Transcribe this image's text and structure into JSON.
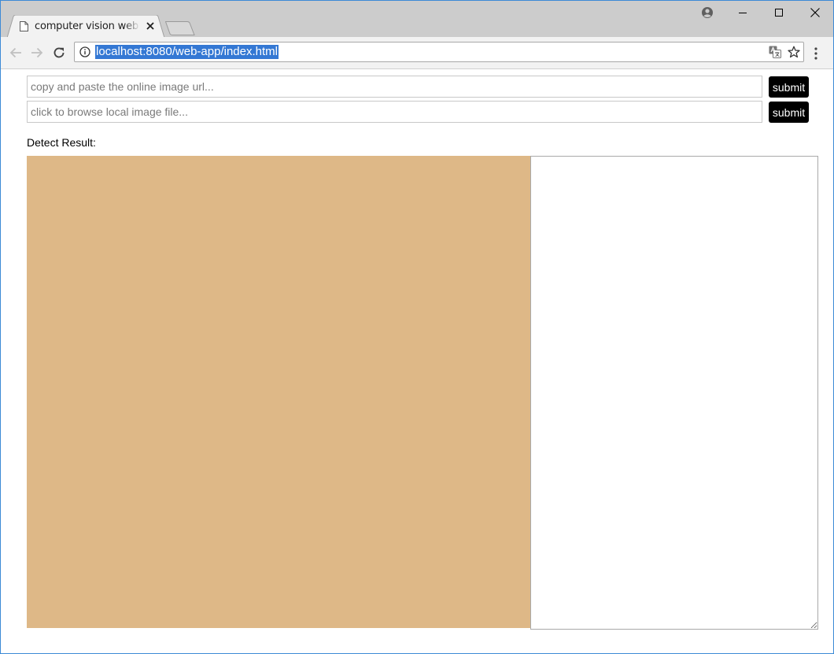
{
  "browser": {
    "tab": {
      "title": "computer vision web app"
    },
    "address_bar": {
      "url": "localhost:8080/web-app/index.html"
    }
  },
  "form": {
    "url_input": {
      "placeholder": "copy and paste the online image url..."
    },
    "url_submit_label": "submit",
    "file_input": {
      "placeholder": "click to browse local image file..."
    },
    "file_submit_label": "submit"
  },
  "result": {
    "label": "Detect Result:",
    "image_panel_color": "#deb887",
    "text": ""
  },
  "colors": {
    "tabstrip": "#cccccc",
    "toolbar": "#f2f2f2",
    "url_highlight": "#3478d4",
    "window_border": "#3c8ad6",
    "button": "#000000"
  }
}
